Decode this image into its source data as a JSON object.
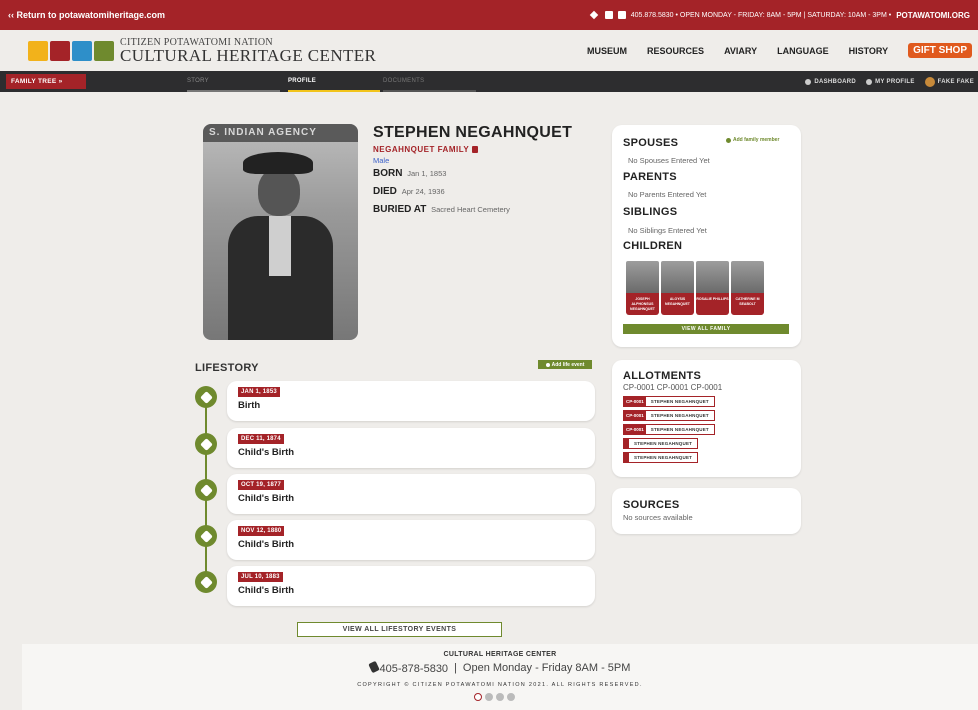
{
  "topbar": {
    "return_link": "‹‹ Return to potawatomiheritage.com",
    "contact_text": "405.878.5830 • OPEN MONDAY - FRIDAY: 8AM - 5PM | SATURDAY: 10AM - 3PM •",
    "site": "POTAWATOMI.ORG",
    "color": "#a42328"
  },
  "brand": {
    "line1": "CITIZEN POTAWATOMI NATION",
    "line2": "CULTURAL HERITAGE CENTER",
    "logo_colors": [
      "#f2b21b",
      "#a42328",
      "#2e8fc9",
      "#6f8a2e"
    ]
  },
  "nav": {
    "items": [
      "MUSEUM",
      "RESOURCES",
      "AVIARY",
      "LANGUAGE",
      "HISTORY"
    ],
    "gift": "GIFT SHOP"
  },
  "subnav": {
    "family_tree": "FAMILY TREE »",
    "tabs": [
      "STORY",
      "PROFILE",
      "DOCUMENTS"
    ],
    "dashboard": "DASHBOARD",
    "my_profile": "MY PROFILE",
    "user": "FAKE FAKE"
  },
  "profile": {
    "portrait_sign": "S. INDIAN AGENCY",
    "name": "STEPHEN NEGAHNQUET",
    "family": "NEGAHNQUET FAMILY",
    "gender": "Male",
    "born_label": "BORN",
    "born_value": "Jan 1, 1853",
    "died_label": "DIED",
    "died_value": "Apr 24, 1936",
    "buried_label": "BURIED AT",
    "buried_value": "Sacred Heart Cemetery"
  },
  "lifestory": {
    "title": "LIFESTORY",
    "add_label": "Add life event",
    "events": [
      {
        "date": "JAN 1, 1853",
        "type": "Birth"
      },
      {
        "date": "DEC 11, 1874",
        "type": "Child's Birth"
      },
      {
        "date": "OCT 19, 1877",
        "type": "Child's Birth"
      },
      {
        "date": "NOV 12, 1880",
        "type": "Child's Birth"
      },
      {
        "date": "JUL 10, 1883",
        "type": "Child's Birth"
      }
    ],
    "view_all": "VIEW ALL LIFESTORY EVENTS"
  },
  "family": {
    "add_member": "Add family member",
    "spouses_h": "SPOUSES",
    "spouses_t": "No Spouses Entered Yet",
    "parents_h": "PARENTS",
    "parents_t": "No Parents Entered Yet",
    "siblings_h": "SIBLINGS",
    "siblings_t": "No Siblings Entered Yet",
    "children_h": "CHILDREN",
    "children": [
      "JOSEPH ALPHONSUS NEGAHNQUET",
      "ALOYSIS NEGAHNQUET",
      "ROSALIE PHILLIPS",
      "CATHERINE M SEABOLT"
    ],
    "view_all": "VIEW ALL FAMILY"
  },
  "allotments": {
    "title": "ALLOTMENTS",
    "codes": "CP-0001 CP-0001 CP-0001",
    "rows": [
      {
        "code": "CP-0001",
        "name": "STEPHEN NEGAHNQUET"
      },
      {
        "code": "CP-0001",
        "name": "STEPHEN NEGAHNQUET"
      },
      {
        "code": "CP-0001",
        "name": "STEPHEN NEGAHNQUET"
      },
      {
        "code": "",
        "name": "STEPHEN NEGAHNQUET"
      },
      {
        "code": "",
        "name": "STEPHEN NEGAHNQUET"
      }
    ]
  },
  "sources": {
    "title": "SOURCES",
    "text": "No sources available"
  },
  "footer": {
    "title": "CULTURAL HERITAGE CENTER",
    "phone": "405-878-5830",
    "sep": "|",
    "hours": "Open Monday - Friday 8AM - 5PM",
    "copyright": "COPYRIGHT © CITIZEN POTAWATOMI NATION 2021. ALL RIGHTS RESERVED."
  },
  "colors": {
    "accent_red": "#a42328",
    "accent_green": "#6f8a2e",
    "accent_yellow": "#f2c41b",
    "gift_orange": "#e05a1e"
  }
}
